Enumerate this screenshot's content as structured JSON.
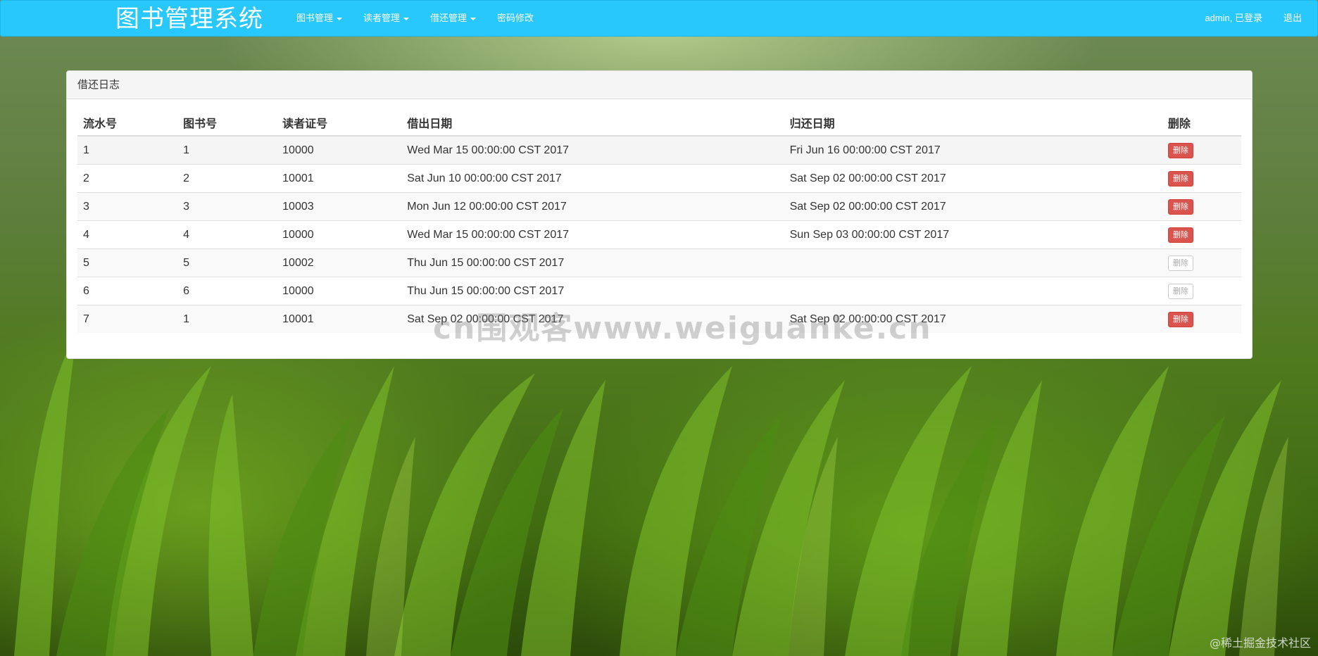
{
  "navbar": {
    "brand": "图书管理系统",
    "menu": [
      {
        "label": "图书管理",
        "dropdown": true
      },
      {
        "label": "读者管理",
        "dropdown": true
      },
      {
        "label": "借还管理",
        "dropdown": true
      },
      {
        "label": "密码修改",
        "dropdown": false
      }
    ],
    "user_status": "admin, 已登录",
    "logout_label": "退出",
    "color": "#28c8fc"
  },
  "panel": {
    "title": "借还日志",
    "columns": [
      "流水号",
      "图书号",
      "读者证号",
      "借出日期",
      "归还日期",
      "删除"
    ],
    "rows": [
      {
        "serial": "1",
        "book_id": "1",
        "reader_id": "10000",
        "lend_date": "Wed Mar 15 00:00:00 CST 2017",
        "return_date": "Fri Jun 16 00:00:00 CST 2017",
        "delete_label": "删除",
        "delete_enabled": true
      },
      {
        "serial": "2",
        "book_id": "2",
        "reader_id": "10001",
        "lend_date": "Sat Jun 10 00:00:00 CST 2017",
        "return_date": "Sat Sep 02 00:00:00 CST 2017",
        "delete_label": "删除",
        "delete_enabled": true
      },
      {
        "serial": "3",
        "book_id": "3",
        "reader_id": "10003",
        "lend_date": "Mon Jun 12 00:00:00 CST 2017",
        "return_date": "Sat Sep 02 00:00:00 CST 2017",
        "delete_label": "删除",
        "delete_enabled": true
      },
      {
        "serial": "4",
        "book_id": "4",
        "reader_id": "10000",
        "lend_date": "Wed Mar 15 00:00:00 CST 2017",
        "return_date": "Sun Sep 03 00:00:00 CST 2017",
        "delete_label": "删除",
        "delete_enabled": true
      },
      {
        "serial": "5",
        "book_id": "5",
        "reader_id": "10002",
        "lend_date": "Thu Jun 15 00:00:00 CST 2017",
        "return_date": "",
        "delete_label": "删除",
        "delete_enabled": false
      },
      {
        "serial": "6",
        "book_id": "6",
        "reader_id": "10000",
        "lend_date": "Thu Jun 15 00:00:00 CST 2017",
        "return_date": "",
        "delete_label": "删除",
        "delete_enabled": false
      },
      {
        "serial": "7",
        "book_id": "1",
        "reader_id": "10001",
        "lend_date": "Sat Sep 02 00:00:00 CST 2017",
        "return_date": "Sat Sep 02 00:00:00 CST 2017",
        "delete_label": "删除",
        "delete_enabled": true
      }
    ]
  },
  "overlay": {
    "watermark": "cn围观客www.weiguanke.cn",
    "corner_mark": "@稀土掘金技术社区"
  }
}
